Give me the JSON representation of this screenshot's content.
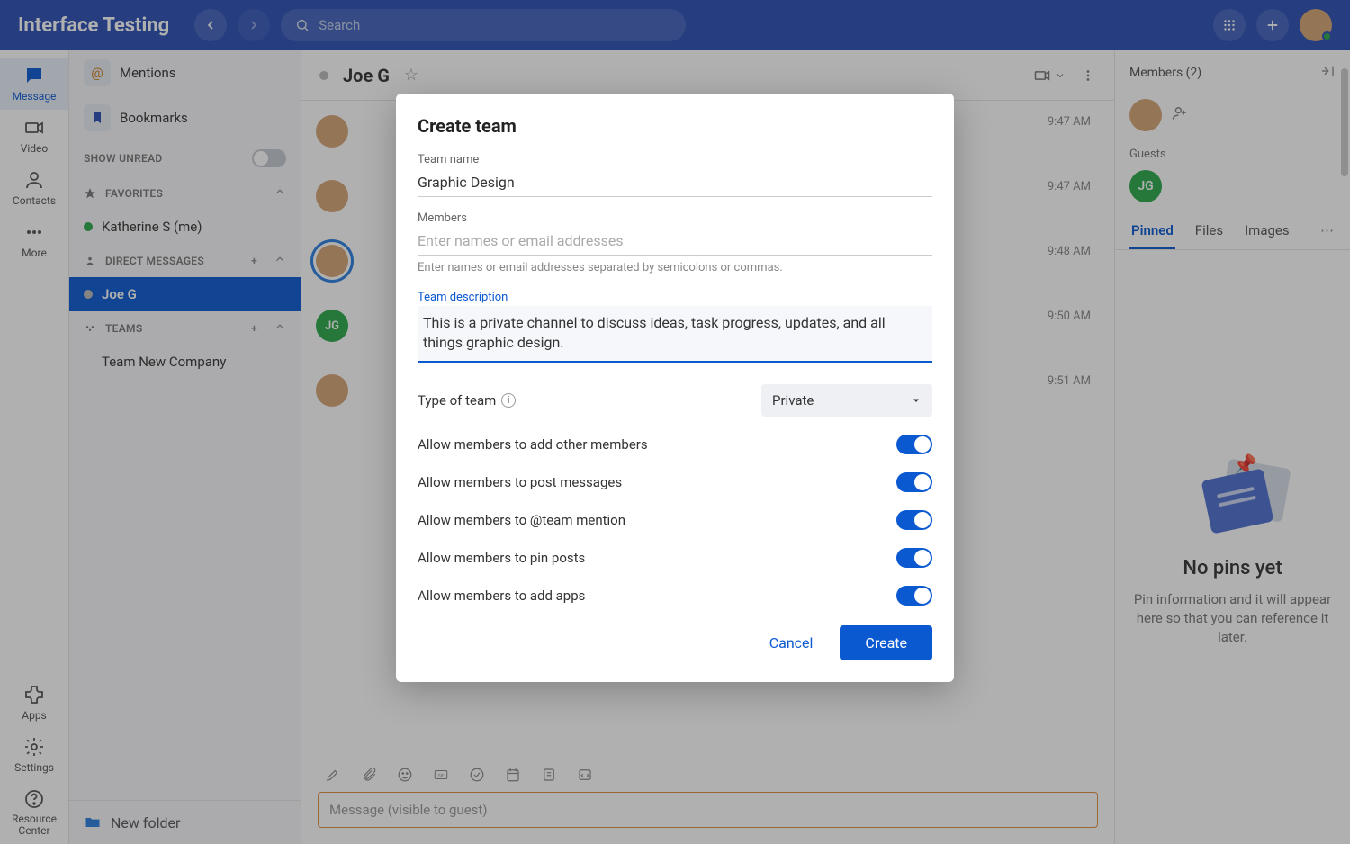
{
  "app": {
    "title": "Interface Testing",
    "search_placeholder": "Search"
  },
  "rail": {
    "message": "Message",
    "video": "Video",
    "contacts": "Contacts",
    "more": "More",
    "apps": "Apps",
    "settings": "Settings",
    "resource": "Resource Center"
  },
  "list": {
    "mentions": "Mentions",
    "bookmarks": "Bookmarks",
    "show_unread": "SHOW UNREAD",
    "favorites": "FAVORITES",
    "me_item": "Katherine S (me)",
    "direct_messages": "DIRECT MESSAGES",
    "dm_selected": "Joe G",
    "teams": "TEAMS",
    "team_item": "Team New Company",
    "new_folder": "New folder"
  },
  "convo": {
    "title": "Joe G",
    "times": [
      "9:47 AM",
      "9:47 AM",
      "9:48 AM",
      "9:50 AM",
      "9:51 AM"
    ],
    "composer_placeholder": "Message (visible to guest)",
    "jg_initials": "JG"
  },
  "right": {
    "members_label": "Members (2)",
    "guests_label": "Guests",
    "guest_initials": "JG",
    "tabs": {
      "pinned": "Pinned",
      "files": "Files",
      "images": "Images"
    },
    "empty_title": "No pins yet",
    "empty_body": "Pin information and it will appear here so that you can reference it later."
  },
  "modal": {
    "title": "Create team",
    "team_name_label": "Team name",
    "team_name_value": "Graphic Design",
    "members_label": "Members",
    "members_placeholder": "Enter names or email addresses",
    "members_helper": "Enter names or email addresses separated by semicolons or commas.",
    "description_label": "Team description",
    "description_value": "This is a private channel to discuss ideas, task progress, updates, and all things graphic design.",
    "type_label": "Type of team",
    "type_value": "Private",
    "opt_add_members": "Allow members to add other members",
    "opt_post": "Allow members to post messages",
    "opt_mention": "Allow members to @team mention",
    "opt_pin": "Allow members to pin posts",
    "opt_apps": "Allow members to add apps",
    "cancel": "Cancel",
    "create": "Create"
  }
}
